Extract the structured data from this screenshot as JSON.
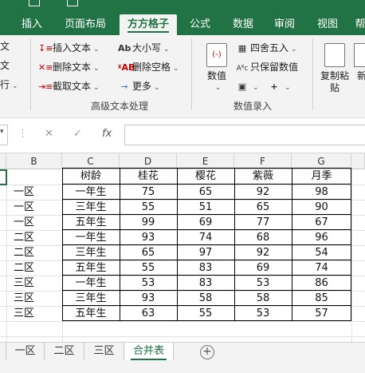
{
  "ribbon_tabs": [
    {
      "label": "插入",
      "active": false
    },
    {
      "label": "页面布局",
      "active": false
    },
    {
      "label": "方方格子",
      "active": true
    },
    {
      "label": "公式",
      "active": false
    },
    {
      "label": "数据",
      "active": false
    },
    {
      "label": "审阅",
      "active": false
    },
    {
      "label": "视图",
      "active": false
    },
    {
      "label": "帮",
      "active": false
    }
  ],
  "ribbon": {
    "left_partial": [
      "文",
      "文",
      "行"
    ],
    "text_group": {
      "insert_text": "插入文本",
      "delete_text": "删除文本",
      "extract_text": "截取文本",
      "case": "大小写",
      "delete_spaces": "删除空格",
      "more": "更多",
      "group_label": "高级文本处理"
    },
    "number_group": {
      "numeric": "数值",
      "round": "四舍五入",
      "keep_values": "只保留数值",
      "group_label": "数值录入"
    },
    "right": {
      "copy_paste": "复制粘贴",
      "new_partial": "新"
    }
  },
  "formula_bar": {
    "fx": "fx",
    "value": ""
  },
  "columns": [
    "B",
    "C",
    "D",
    "E",
    "F",
    "G"
  ],
  "table": {
    "headers": [
      "树龄",
      "桂花",
      "樱花",
      "紫薇",
      "月季"
    ],
    "rows": [
      {
        "b": "一区",
        "age": "一年生",
        "v": [
          "75",
          "65",
          "92",
          "98"
        ]
      },
      {
        "b": "一区",
        "age": "三年生",
        "v": [
          "55",
          "51",
          "65",
          "90"
        ]
      },
      {
        "b": "一区",
        "age": "五年生",
        "v": [
          "99",
          "69",
          "77",
          "67"
        ]
      },
      {
        "b": "二区",
        "age": "一年生",
        "v": [
          "93",
          "74",
          "68",
          "96"
        ]
      },
      {
        "b": "二区",
        "age": "三年生",
        "v": [
          "65",
          "97",
          "92",
          "54"
        ]
      },
      {
        "b": "二区",
        "age": "五年生",
        "v": [
          "55",
          "83",
          "69",
          "74"
        ]
      },
      {
        "b": "三区",
        "age": "一年生",
        "v": [
          "53",
          "83",
          "53",
          "86"
        ]
      },
      {
        "b": "三区",
        "age": "三年生",
        "v": [
          "93",
          "58",
          "58",
          "85"
        ]
      },
      {
        "b": "三区",
        "age": "五年生",
        "v": [
          "63",
          "55",
          "53",
          "57"
        ]
      }
    ]
  },
  "sheets": [
    {
      "label": "一区",
      "active": false
    },
    {
      "label": "二区",
      "active": false
    },
    {
      "label": "三区",
      "active": false
    },
    {
      "label": "合并表",
      "active": true
    }
  ],
  "colors": {
    "accent": "#217346"
  }
}
